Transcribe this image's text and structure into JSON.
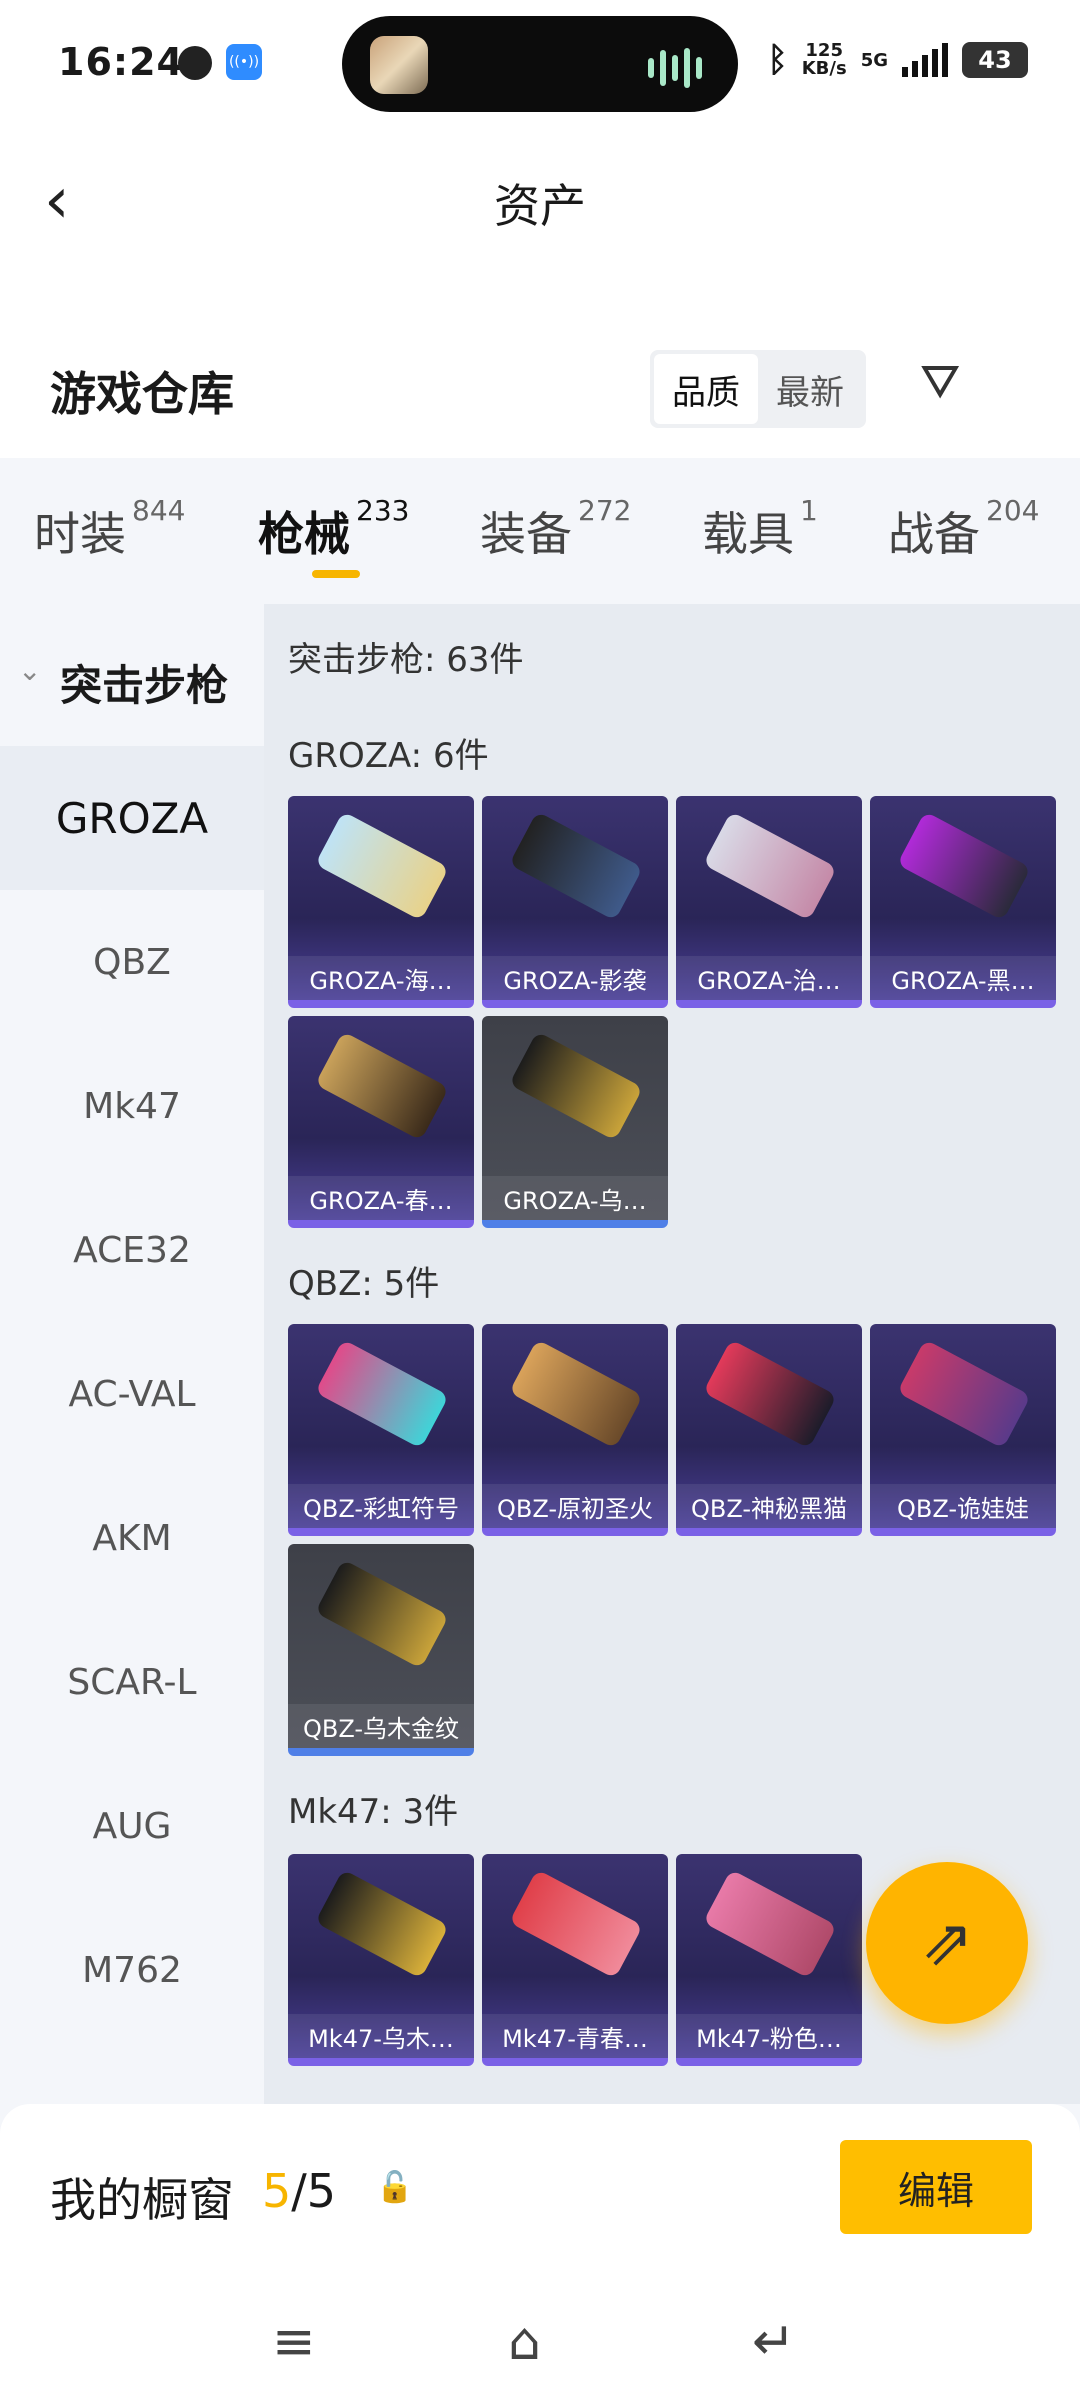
{
  "status": {
    "time": "16:24",
    "speed_top": "125",
    "speed_bottom": "KB/s",
    "net": "5G",
    "battery": "43"
  },
  "header": {
    "title": "资产"
  },
  "warehouse": {
    "title": "游戏仓库",
    "sort": [
      "品质",
      "最新"
    ]
  },
  "tabs": [
    {
      "label": "时装",
      "count": "844"
    },
    {
      "label": "枪械",
      "count": "233"
    },
    {
      "label": "装备",
      "count": "272"
    },
    {
      "label": "载具",
      "count": "1"
    },
    {
      "label": "战备",
      "count": "204"
    }
  ],
  "categories": {
    "group": "突击步枪",
    "items": [
      "GROZA",
      "QBZ",
      "Mk47",
      "ACE32",
      "AC-VAL",
      "AKM",
      "SCAR-L",
      "AUG",
      "M762"
    ]
  },
  "content": {
    "summary": "突击步枪: 63件",
    "groups": [
      {
        "title": "GROZA: 6件",
        "items": [
          "GROZA-海…",
          "GROZA-影袭",
          "GROZA-治…",
          "GROZA-黑…",
          "GROZA-春…",
          "GROZA-乌…"
        ]
      },
      {
        "title": "QBZ: 5件",
        "items": [
          "QBZ-彩虹符号",
          "QBZ-原初圣火",
          "QBZ-神秘黑猫",
          "QBZ-诡娃娃",
          "QBZ-乌木金纹"
        ]
      },
      {
        "title": "Mk47: 3件",
        "items": [
          "Mk47-乌木…",
          "Mk47-青春…",
          "Mk47-粉色…"
        ]
      }
    ]
  },
  "showcase": {
    "label": "我的橱窗",
    "current": "5",
    "total": "/5",
    "edit": "编辑"
  },
  "icons": {
    "back": "chevron-left-icon",
    "filter": "filter-icon",
    "share": "share-icon",
    "lock": "lock-icon",
    "menu": "menu-icon",
    "home": "home-icon",
    "return": "back-icon"
  },
  "colors": {
    "accent": "#ffbe00",
    "card_purple": "#2a2557",
    "card_grey": "#4c4f58"
  }
}
